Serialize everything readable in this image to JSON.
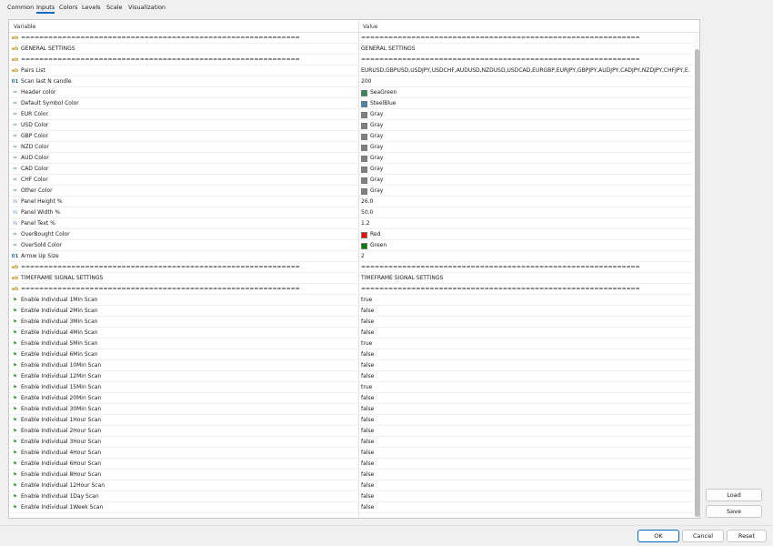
{
  "tabs": [
    {
      "label": "Common"
    },
    {
      "label": "Inputs"
    },
    {
      "label": "Colors"
    },
    {
      "label": "Levels"
    },
    {
      "label": "Scale"
    },
    {
      "label": "Visualization"
    }
  ],
  "active_tab": "Inputs",
  "table": {
    "col_variable": "Variable",
    "col_value": "Value",
    "rows": [
      {
        "type": "ab",
        "icon": "ab",
        "variable": "=============================================================",
        "value": "============================================================="
      },
      {
        "type": "ab",
        "icon": "ab",
        "variable": "GENERAL SETTINGS",
        "value": "GENERAL SETTINGS"
      },
      {
        "type": "ab",
        "icon": "ab",
        "variable": "=============================================================",
        "value": "============================================================="
      },
      {
        "type": "ab",
        "icon": "ab",
        "variable": "Pairs List",
        "value": "EURUSD,GBPUSD,USDJPY,USDCHF,AUDUSD,NZDUSD,USDCAD,EURGBP,EURJPY,GBPJPY,AUDJPY,CADJPY,NZDJPY,CHFJPY,E..."
      },
      {
        "type": "num",
        "icon": "01",
        "variable": "Scan last N candle",
        "value": "200"
      },
      {
        "type": "color",
        "icon": "♒",
        "variable": "Header color",
        "value": "SeaGreen",
        "swatch": "#2e8b57"
      },
      {
        "type": "color",
        "icon": "♒",
        "variable": "Default Symbol Color",
        "value": "SteelBlue",
        "swatch": "#4682b4"
      },
      {
        "type": "color",
        "icon": "♒",
        "variable": "EUR Color",
        "value": "Gray",
        "swatch": "#808080"
      },
      {
        "type": "color",
        "icon": "♒",
        "variable": "USD Color",
        "value": "Gray",
        "swatch": "#808080"
      },
      {
        "type": "color",
        "icon": "♒",
        "variable": "GBP Color",
        "value": "Gray",
        "swatch": "#808080"
      },
      {
        "type": "color",
        "icon": "♒",
        "variable": "NZD Color",
        "value": "Gray",
        "swatch": "#808080"
      },
      {
        "type": "color",
        "icon": "♒",
        "variable": "AUD Color",
        "value": "Gray",
        "swatch": "#808080"
      },
      {
        "type": "color",
        "icon": "♒",
        "variable": "CAD Color",
        "value": "Gray",
        "swatch": "#808080"
      },
      {
        "type": "color",
        "icon": "♒",
        "variable": "CHF Color",
        "value": "Gray",
        "swatch": "#808080"
      },
      {
        "type": "color",
        "icon": "♒",
        "variable": "Other Color",
        "value": "Gray",
        "swatch": "#808080"
      },
      {
        "type": "frac",
        "icon": "½",
        "variable": "Panel Height %",
        "value": "26.0"
      },
      {
        "type": "frac",
        "icon": "½",
        "variable": "Panel Width %",
        "value": "50.0"
      },
      {
        "type": "frac",
        "icon": "½",
        "variable": "Panel Text %",
        "value": "1.2"
      },
      {
        "type": "color",
        "icon": "♒",
        "variable": "OverBought Color",
        "value": "Red",
        "swatch": "#ff0000"
      },
      {
        "type": "color",
        "icon": "♒",
        "variable": "OverSold Color",
        "value": "Green",
        "swatch": "#008000"
      },
      {
        "type": "num",
        "icon": "01",
        "variable": "Arrow Up Size",
        "value": "2"
      },
      {
        "type": "ab",
        "icon": "ab",
        "variable": "=============================================================",
        "value": "============================================================="
      },
      {
        "type": "ab",
        "icon": "ab",
        "variable": "TIMEFRAME SIGNAL SETTINGS",
        "value": "TIMEFRAME SIGNAL SETTINGS"
      },
      {
        "type": "ab",
        "icon": "ab",
        "variable": "=============================================================",
        "value": "============================================================="
      },
      {
        "type": "flag",
        "icon": "⚑",
        "variable": "Enable Individual 1Min Scan",
        "value": "true"
      },
      {
        "type": "flag",
        "icon": "⚑",
        "variable": "Enable Individual 2Min Scan",
        "value": "false"
      },
      {
        "type": "flag",
        "icon": "⚑",
        "variable": "Enable Individual 3Min Scan",
        "value": "false"
      },
      {
        "type": "flag",
        "icon": "⚑",
        "variable": "Enable Individual 4Min Scan",
        "value": "false"
      },
      {
        "type": "flag",
        "icon": "⚑",
        "variable": "Enable Individual 5Min Scan",
        "value": "true"
      },
      {
        "type": "flag",
        "icon": "⚑",
        "variable": "Enable Individual 6Min Scan",
        "value": "false"
      },
      {
        "type": "flag",
        "icon": "⚑",
        "variable": "Enable Individual 10Min Scan",
        "value": "false"
      },
      {
        "type": "flag",
        "icon": "⚑",
        "variable": "Enable Individual 12Min Scan",
        "value": "false"
      },
      {
        "type": "flag",
        "icon": "⚑",
        "variable": "Enable Individual 15Min Scan",
        "value": "true"
      },
      {
        "type": "flag",
        "icon": "⚑",
        "variable": "Enable Individual 20Min Scan",
        "value": "false"
      },
      {
        "type": "flag",
        "icon": "⚑",
        "variable": "Enable Individual 30Min Scan",
        "value": "false"
      },
      {
        "type": "flag",
        "icon": "⚑",
        "variable": "Enable Individual 1Hour Scan",
        "value": "false"
      },
      {
        "type": "flag",
        "icon": "⚑",
        "variable": "Enable Individual 2Hour Scan",
        "value": "false"
      },
      {
        "type": "flag",
        "icon": "⚑",
        "variable": "Enable Individual 3Hour Scan",
        "value": "false"
      },
      {
        "type": "flag",
        "icon": "⚑",
        "variable": "Enable Individual 4Hour Scan",
        "value": "false"
      },
      {
        "type": "flag",
        "icon": "⚑",
        "variable": "Enable Individual 6Hour Scan",
        "value": "false"
      },
      {
        "type": "flag",
        "icon": "⚑",
        "variable": "Enable Individual 8Hour Scan",
        "value": "false"
      },
      {
        "type": "flag",
        "icon": "⚑",
        "variable": "Enable Individual 12Hour Scan",
        "value": "false"
      },
      {
        "type": "flag",
        "icon": "⚑",
        "variable": "Enable Individual 1Day Scan",
        "value": "false"
      },
      {
        "type": "flag",
        "icon": "⚑",
        "variable": "Enable Individual 1Week Scan",
        "value": "false"
      }
    ]
  },
  "buttons": {
    "load": "Load",
    "save": "Save",
    "ok": "OK",
    "cancel": "Cancel",
    "reset": "Reset"
  }
}
